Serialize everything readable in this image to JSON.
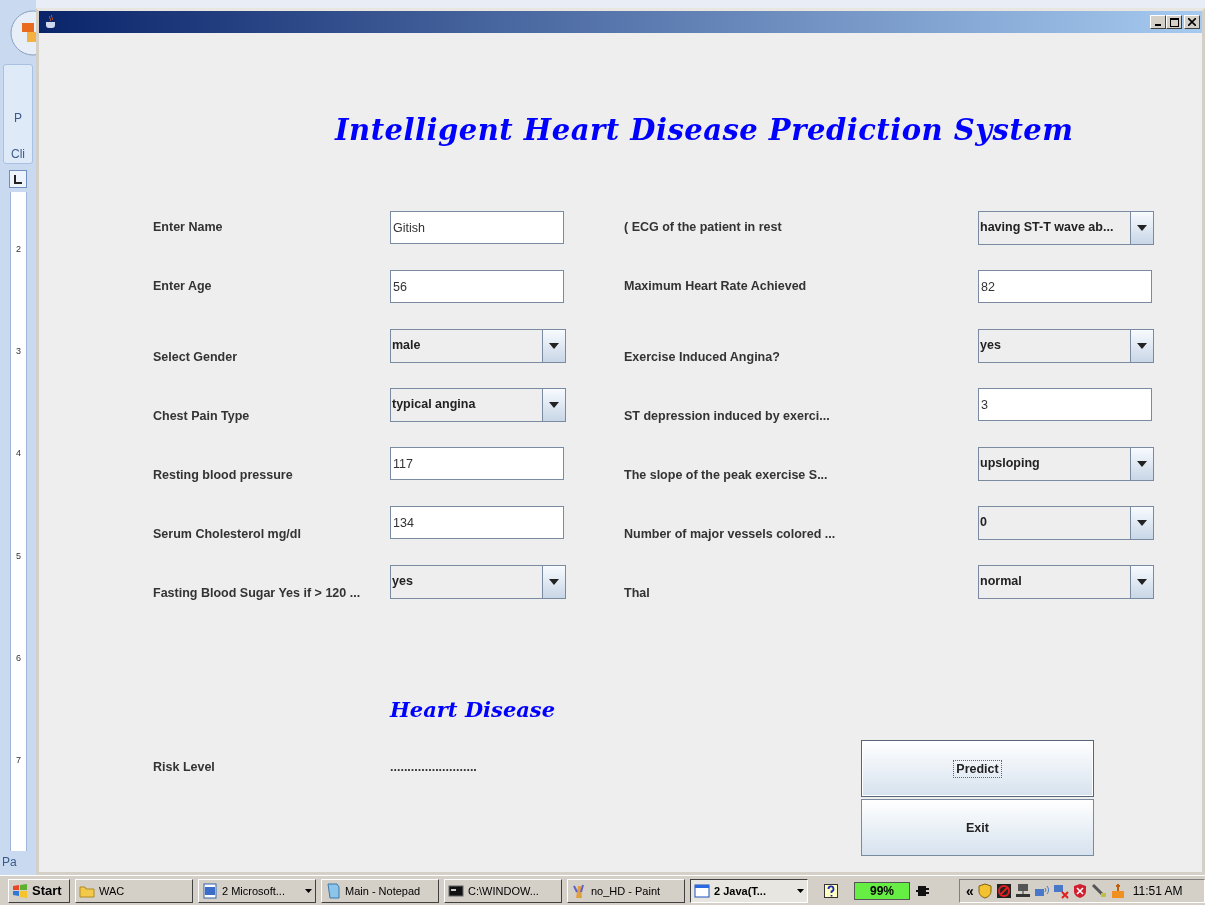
{
  "word_background": {
    "ribbon_texts": [
      "P",
      "Cli"
    ],
    "ruler_numbers": [
      "2",
      "3",
      "4",
      "5",
      "6",
      "7"
    ],
    "status_text": "Pa"
  },
  "heading": "Intelligent Heart Disease Prediction System",
  "left_fields": [
    {
      "label": "Enter  Name",
      "kind": "text",
      "value": "Gitish"
    },
    {
      "label": "Enter  Age",
      "kind": "text",
      "value": "56"
    },
    {
      "label": "Select Gender",
      "kind": "combo",
      "value": "male"
    },
    {
      "label": "Chest Pain Type",
      "kind": "combo",
      "value": "typical angina"
    },
    {
      "label": "Resting blood pressure",
      "kind": "text",
      "value": "117"
    },
    {
      "label": "Serum Cholesterol mg/dl",
      "kind": "text",
      "value": "134"
    },
    {
      "label": "Fasting Blood Sugar Yes if > 120 ...",
      "kind": "combo",
      "value": "yes"
    }
  ],
  "right_fields": [
    {
      "label": "( ECG of the patient in rest",
      "kind": "combo",
      "value": "having ST-T wave ab..."
    },
    {
      "label": "Maximum Heart Rate Achieved",
      "kind": "text",
      "value": "82"
    },
    {
      "label": "Exercise Induced Angina?",
      "kind": "combo",
      "value": "yes"
    },
    {
      "label": "ST depression induced by exerci...",
      "kind": "text",
      "value": "3"
    },
    {
      "label": "The slope of the peak exercise S...",
      "kind": "combo",
      "value": "upsloping"
    },
    {
      "label": "Number of major vessels colored ...",
      "kind": "combo",
      "value": "0"
    },
    {
      "label": "Thal",
      "kind": "combo",
      "value": "normal"
    }
  ],
  "result": {
    "heading": "Heart Disease",
    "label": "Risk Level",
    "value": "........................."
  },
  "buttons": [
    {
      "label": "Predict",
      "focused": true
    },
    {
      "label": "Exit",
      "focused": false
    }
  ],
  "taskbar": {
    "start": "Start",
    "tasks": [
      {
        "label": "WAC",
        "selected": false,
        "grouped": false
      },
      {
        "label": "2 Microsoft...",
        "selected": false,
        "grouped": true
      },
      {
        "label": "Main - Notepad",
        "selected": false,
        "grouped": false
      },
      {
        "label": "C:\\WINDOW...",
        "selected": false,
        "grouped": false
      },
      {
        "label": "no_HD - Paint",
        "selected": false,
        "grouped": false
      },
      {
        "label": "2 Java(T...",
        "selected": true,
        "grouped": true
      }
    ],
    "battery": "99%",
    "tray_chevron": "«",
    "clock": "11:51 AM"
  }
}
